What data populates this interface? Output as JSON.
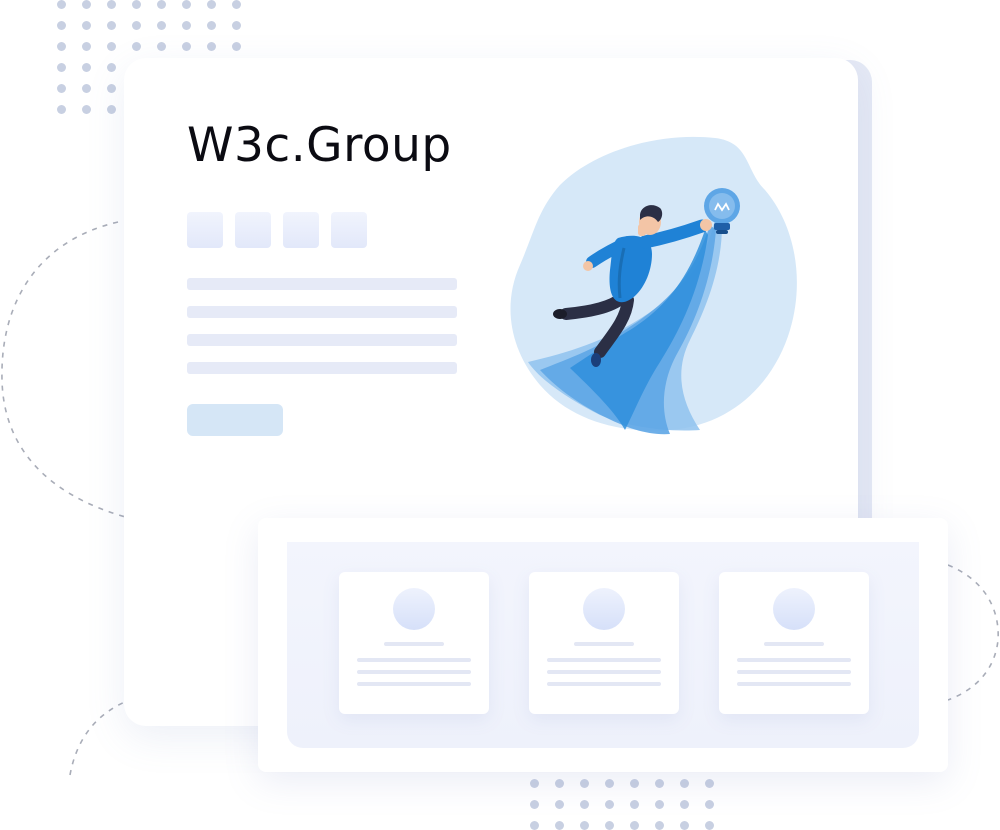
{
  "brand": {
    "title": "W3c.Group"
  },
  "colors": {
    "accent": "#1f82d6",
    "accent_light": "#5ea6e6",
    "blob": "#d6e8f8",
    "placeholder": "#e6eaf7",
    "dots": "#c8d0e2",
    "title": "#0b0b12"
  },
  "icons": {
    "hero": "person-flying-with-lightbulb-illustration",
    "bulb": "lightbulb-icon"
  },
  "cards": [
    {
      "avatar": "avatar-placeholder"
    },
    {
      "avatar": "avatar-placeholder"
    },
    {
      "avatar": "avatar-placeholder"
    }
  ]
}
